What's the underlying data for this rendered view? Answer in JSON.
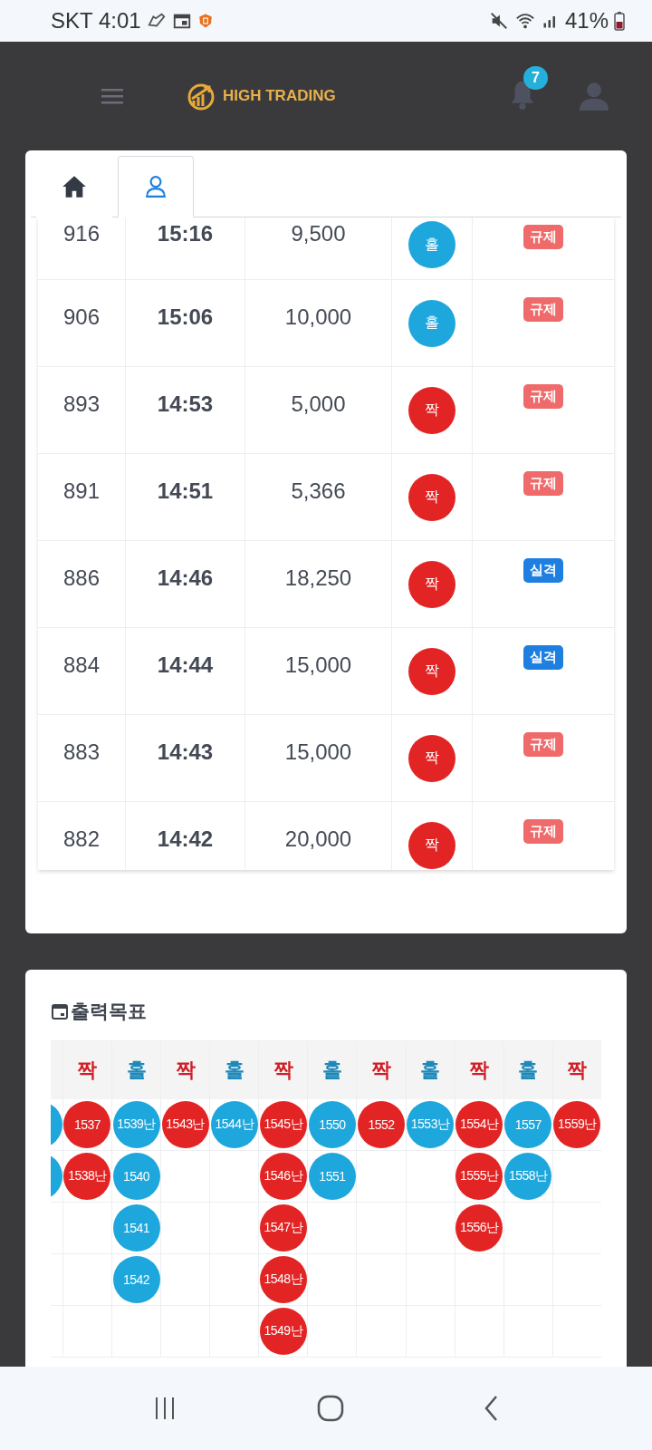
{
  "status_bar": {
    "carrier_time": "SKT 4:01",
    "battery": "41%"
  },
  "header": {
    "brand": "HIGH TRADING",
    "notifications": "7"
  },
  "tabs": [
    {
      "kind": "home",
      "selected": false
    },
    {
      "kind": "user",
      "selected": true
    }
  ],
  "rows": [
    {
      "no": "916",
      "time": "15:16",
      "amount": "9,500",
      "result": {
        "kind": "odd",
        "label": "홀"
      },
      "status": {
        "kind": "regulated",
        "label": "규제"
      }
    },
    {
      "no": "906",
      "time": "15:06",
      "amount": "10,000",
      "result": {
        "kind": "odd",
        "label": "홀"
      },
      "status": {
        "kind": "regulated",
        "label": "규제"
      }
    },
    {
      "no": "893",
      "time": "14:53",
      "amount": "5,000",
      "result": {
        "kind": "even",
        "label": "짝"
      },
      "status": {
        "kind": "regulated",
        "label": "규제"
      }
    },
    {
      "no": "891",
      "time": "14:51",
      "amount": "5,366",
      "result": {
        "kind": "even",
        "label": "짝"
      },
      "status": {
        "kind": "regulated",
        "label": "규제"
      }
    },
    {
      "no": "886",
      "time": "14:46",
      "amount": "18,250",
      "result": {
        "kind": "even",
        "label": "짝"
      },
      "status": {
        "kind": "disqualified",
        "label": "실격"
      }
    },
    {
      "no": "884",
      "time": "14:44",
      "amount": "15,000",
      "result": {
        "kind": "even",
        "label": "짝"
      },
      "status": {
        "kind": "disqualified",
        "label": "실격"
      }
    },
    {
      "no": "883",
      "time": "14:43",
      "amount": "15,000",
      "result": {
        "kind": "even",
        "label": "짝"
      },
      "status": {
        "kind": "regulated",
        "label": "규제"
      }
    },
    {
      "no": "882",
      "time": "14:42",
      "amount": "20,000",
      "result": {
        "kind": "even",
        "label": "짝"
      },
      "status": {
        "kind": "regulated",
        "label": "규제"
      }
    }
  ],
  "target": {
    "title": "출력목표",
    "columns": [
      {
        "kind": "odd",
        "clipped": true,
        "balls": [
          {
            "kind": "partial"
          },
          {
            "kind": "partial"
          }
        ]
      },
      {
        "kind": "even",
        "header": "짝",
        "balls": [
          {
            "label": "1537"
          },
          {
            "label": "1538난"
          }
        ]
      },
      {
        "kind": "odd",
        "header": "홀",
        "balls": [
          {
            "label": "1539난"
          },
          {
            "label": "1540"
          },
          {
            "label": "1541"
          },
          {
            "label": "1542"
          }
        ]
      },
      {
        "kind": "even",
        "header": "짝",
        "balls": [
          {
            "label": "1543난"
          }
        ]
      },
      {
        "kind": "odd",
        "header": "홀",
        "balls": [
          {
            "label": "1544난"
          }
        ]
      },
      {
        "kind": "even",
        "header": "짝",
        "balls": [
          {
            "label": "1545난"
          },
          {
            "label": "1546난"
          },
          {
            "label": "1547난"
          },
          {
            "label": "1548난"
          },
          {
            "label": "1549난"
          }
        ]
      },
      {
        "kind": "odd",
        "header": "홀",
        "balls": [
          {
            "label": "1550"
          },
          {
            "label": "1551"
          }
        ]
      },
      {
        "kind": "even",
        "header": "짝",
        "balls": [
          {
            "label": "1552"
          }
        ]
      },
      {
        "kind": "odd",
        "header": "홀",
        "balls": [
          {
            "label": "1553난"
          }
        ]
      },
      {
        "kind": "even",
        "header": "짝",
        "balls": [
          {
            "label": "1554난"
          },
          {
            "label": "1555난"
          },
          {
            "label": "1556난"
          }
        ]
      },
      {
        "kind": "odd",
        "header": "홀",
        "balls": [
          {
            "label": "1557"
          },
          {
            "label": "1558난"
          }
        ]
      },
      {
        "kind": "even",
        "header": "짝",
        "balls": [
          {
            "label": "1559난"
          }
        ]
      }
    ]
  }
}
